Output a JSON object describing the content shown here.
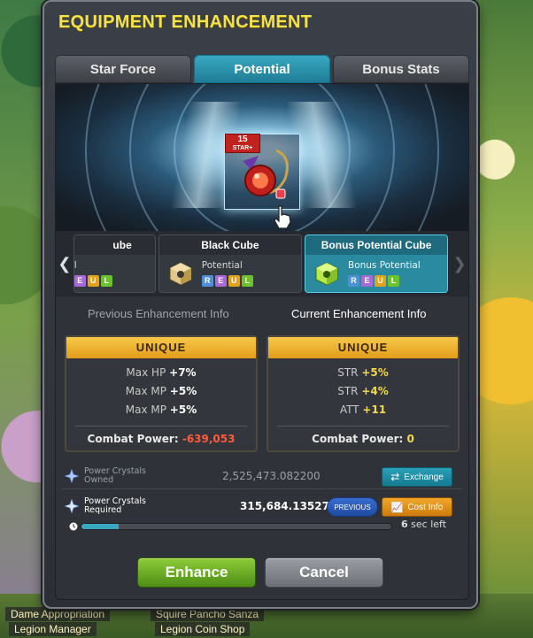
{
  "window": {
    "title": "EQUIPMENT ENHANCEMENT"
  },
  "tabs": [
    {
      "label": "Star Force",
      "active": false
    },
    {
      "label": "Potential",
      "active": true
    },
    {
      "label": "Bonus Stats",
      "active": false
    }
  ],
  "item": {
    "star_badge_top": "15",
    "star_badge_bottom": "STAR+",
    "icon": "red-pendant-item-icon"
  },
  "cubes": [
    {
      "name": "ube",
      "kind": "l",
      "tiers": [
        "E",
        "U",
        "L"
      ],
      "icon": "red-cube-icon"
    },
    {
      "name": "Black Cube",
      "kind": "Potential",
      "tiers": [
        "R",
        "E",
        "U",
        "L"
      ],
      "icon": "black-cube-icon"
    },
    {
      "name": "Bonus Potential Cube",
      "kind": "Bonus Potential",
      "tiers": [
        "R",
        "E",
        "U",
        "L"
      ],
      "icon": "bonus-potential-cube-icon",
      "selected": true
    }
  ],
  "previous": {
    "heading": "Previous Enhancement Info",
    "grade": "UNIQUE",
    "lines": [
      {
        "stat": "Max HP",
        "value": "+7%"
      },
      {
        "stat": "Max MP",
        "value": "+5%"
      },
      {
        "stat": "Max MP",
        "value": "+5%"
      }
    ],
    "combat_label": "Combat Power:",
    "combat_value": "-639,053"
  },
  "current": {
    "heading": "Current Enhancement Info",
    "grade": "UNIQUE",
    "lines": [
      {
        "stat": "STR",
        "value": "+5%"
      },
      {
        "stat": "STR",
        "value": "+4%"
      },
      {
        "stat": "ATT",
        "value": "+11"
      }
    ],
    "combat_label": "Combat Power:",
    "combat_value": "0"
  },
  "crystals": {
    "owned_label_1": "Power Crystals",
    "owned_label_2": "Owned",
    "owned_value": "2,525,473.082200",
    "exchange_label": "Exchange",
    "required_label_1": "Power Crystals",
    "required_label_2": "Required",
    "required_value": "315,684.135275",
    "previous_label": "PREVIOUS",
    "cost_info_label": "Cost Info"
  },
  "timer": {
    "seconds": "6",
    "suffix": "sec left",
    "progress_fraction": 0.12
  },
  "actions": {
    "enhance_label": "Enhance",
    "cancel_label": "Cancel"
  },
  "npcs": [
    {
      "label": "Dame Appropriation"
    },
    {
      "label": "Legion Manager"
    },
    {
      "label": "Squire Pancho Sanza"
    },
    {
      "label": "Legion Coin Shop"
    }
  ],
  "colors": {
    "accent_tab": "#2a90aa",
    "grade_unique": "#f0b030",
    "title_yellow": "#f4e24a",
    "enhance_green": "#6aa520",
    "combat_negative": "#ff5a3c",
    "stat_positive_yellow": "#f4d84a"
  }
}
